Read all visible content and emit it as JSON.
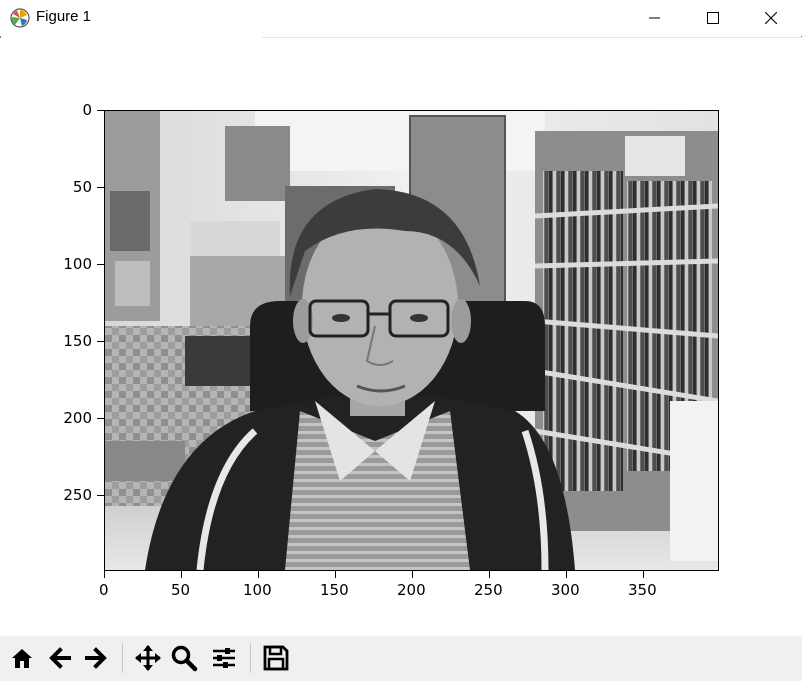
{
  "window": {
    "title": "Figure 1"
  },
  "plot": {
    "x_ticks": [
      "0",
      "50",
      "100",
      "150",
      "200",
      "250",
      "300",
      "350"
    ],
    "y_ticks": [
      "0",
      "50",
      "100",
      "150",
      "200",
      "250"
    ],
    "image_description": "grayscale webcam photo of a man with glasses in an office with bookshelves"
  },
  "toolbar": {
    "buttons": [
      "home",
      "back",
      "forward",
      "pan",
      "zoom",
      "configure-subplots",
      "save"
    ]
  },
  "colors": {
    "toolbar_bg": "#f0f0f0",
    "frame": "#000000"
  }
}
